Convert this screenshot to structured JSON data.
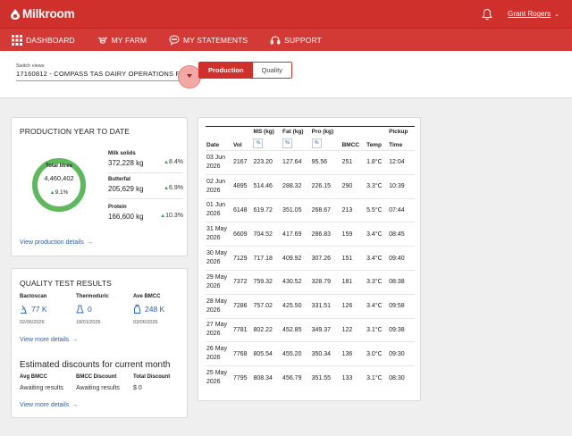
{
  "app": {
    "logo_text": "Milkroom",
    "user_name": "Grant Rogers"
  },
  "nav": [
    {
      "label": "DASHBOARD",
      "icon": "grid-icon"
    },
    {
      "label": "MY FARM",
      "icon": "cow-icon"
    },
    {
      "label": "MY STATEMENTS",
      "icon": "chat-icon"
    },
    {
      "label": "SUPPORT",
      "icon": "headset-icon"
    }
  ],
  "switch_views": {
    "label": "Switch views",
    "value": "17160812 - COMPASS TAS DAIRY OPERATIONS PT..."
  },
  "view_toggle": {
    "production": "Production",
    "quality": "Quality",
    "selected": "Production"
  },
  "production_card": {
    "title": "PRODUCTION YEAR TO DATE",
    "total_label": "Total litres",
    "total_value": "4,460,402",
    "total_pct": "9.1%",
    "ring_progress": 1.0,
    "metrics": [
      {
        "label": "Milk solids",
        "value": "372,228 kg",
        "pct": "8.4%"
      },
      {
        "label": "Butterfat",
        "value": "205,629 kg",
        "pct": "6.9%"
      },
      {
        "label": "Protein",
        "value": "166,600 kg",
        "pct": "10.3%"
      }
    ],
    "link": "View production details"
  },
  "quality_card": {
    "title": "QUALITY TEST RESULTS",
    "tests": [
      {
        "label": "Bactoscan",
        "value": "77 K",
        "date": "02/06/2026",
        "icon": "microscope-icon"
      },
      {
        "label": "Thermoduric",
        "value": "0",
        "date": "18/01/2026",
        "icon": "flask-icon"
      },
      {
        "label": "Ave BMCC",
        "value": "248 K",
        "date": "03/06/2026",
        "icon": "bottle-icon"
      }
    ],
    "link1": "View more details",
    "discount_title": "Estimated discounts for current month",
    "discounts": [
      {
        "label": "Avg BMCC",
        "value": "Awaiting results"
      },
      {
        "label": "BMCC Discount",
        "value": "Awaiting results"
      },
      {
        "label": "Total Discount",
        "value": "$ 0"
      }
    ],
    "link2": "View more details"
  },
  "collections_table": {
    "headers": {
      "date": "Date",
      "vol": "Vol",
      "ms": "MS (kg)",
      "fat": "Fat (kg)",
      "pro": "Pro (kg)",
      "pct": "%",
      "bmcc": "BMCC",
      "temp": "Temp",
      "pickup": "Pickup",
      "time": "Time"
    },
    "rows": [
      {
        "date1": "03 Jun",
        "date2": "2026",
        "vol": "2167",
        "ms": "223.20",
        "fat": "127.64",
        "pro": "95.56",
        "bmcc": "251",
        "temp": "1.8°C",
        "time": "12:04"
      },
      {
        "date1": "02 Jun",
        "date2": "2026",
        "vol": "4895",
        "ms": "514.46",
        "fat": "288.32",
        "pro": "226.15",
        "bmcc": "290",
        "temp": "3.3°C",
        "time": "10:39"
      },
      {
        "date1": "01 Jun",
        "date2": "2026",
        "vol": "6148",
        "ms": "619.72",
        "fat": "351.05",
        "pro": "268.67",
        "bmcc": "213",
        "temp": "5.5°C",
        "time": "07:44"
      },
      {
        "date1": "31 May",
        "date2": "2026",
        "vol": "6609",
        "ms": "704.52",
        "fat": "417.69",
        "pro": "286.83",
        "bmcc": "159",
        "temp": "3.4°C",
        "time": "08:45"
      },
      {
        "date1": "30 May",
        "date2": "2026",
        "vol": "7129",
        "ms": "717.18",
        "fat": "409.92",
        "pro": "307.26",
        "bmcc": "151",
        "temp": "3.4°C",
        "time": "09:40"
      },
      {
        "date1": "29 May",
        "date2": "2026",
        "vol": "7372",
        "ms": "759.32",
        "fat": "430.52",
        "pro": "328.79",
        "bmcc": "181",
        "temp": "3.3°C",
        "time": "08:38"
      },
      {
        "date1": "28 May",
        "date2": "2026",
        "vol": "7286",
        "ms": "757.02",
        "fat": "425.50",
        "pro": "331.51",
        "bmcc": "126",
        "temp": "3.4°C",
        "time": "09:58"
      },
      {
        "date1": "27 May",
        "date2": "2026",
        "vol": "7781",
        "ms": "802.22",
        "fat": "452.85",
        "pro": "349.37",
        "bmcc": "122",
        "temp": "3.1°C",
        "time": "09:38"
      },
      {
        "date1": "26 May",
        "date2": "2026",
        "vol": "7768",
        "ms": "805.54",
        "fat": "455.20",
        "pro": "350.34",
        "bmcc": "136",
        "temp": "3.0°C",
        "time": "09:30"
      },
      {
        "date1": "25 May",
        "date2": "2026",
        "vol": "7795",
        "ms": "808.34",
        "fat": "456.79",
        "pro": "351.55",
        "bmcc": "133",
        "temp": "3.1°C",
        "time": "08:30"
      }
    ]
  },
  "colors": {
    "brand_red": "#d0302b",
    "accent_blue": "#2563b5",
    "ring_green": "#5cba5c",
    "up_green": "#3aa14a"
  }
}
